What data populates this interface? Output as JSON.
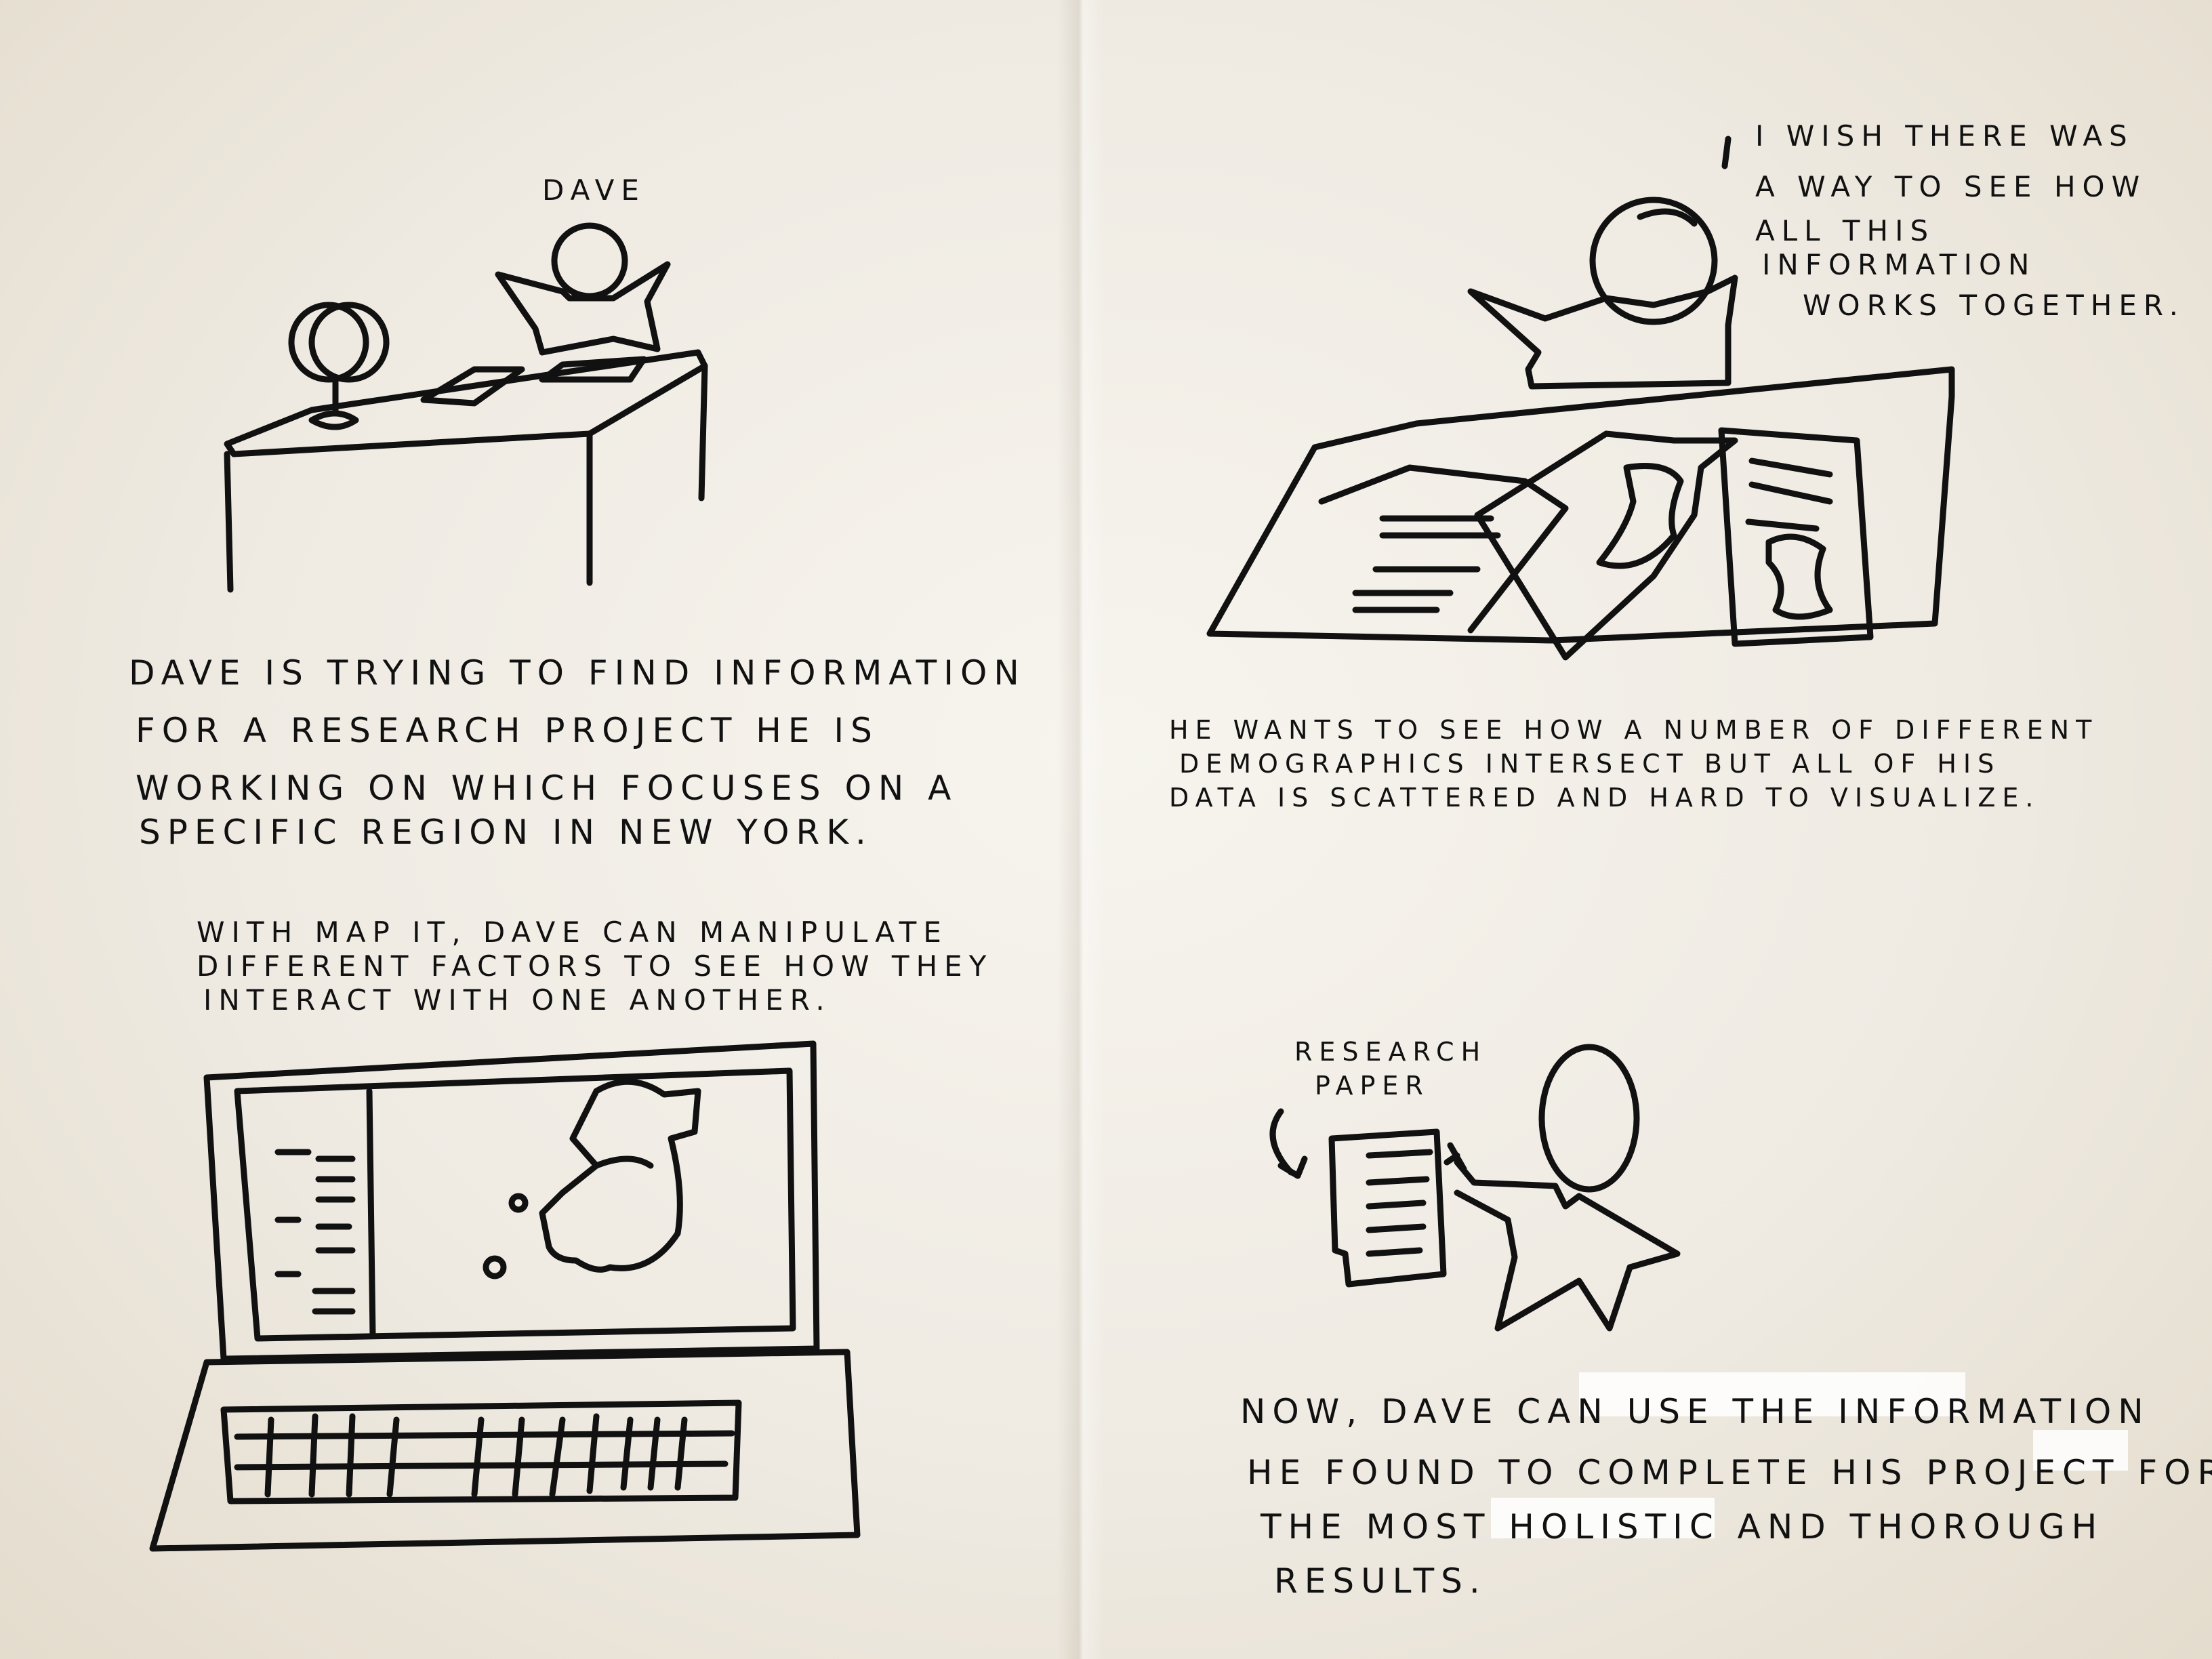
{
  "panel1": {
    "character_label": "DAVE",
    "caption": [
      "DAVE IS TRYING TO FIND INFORMATION",
      "FOR A RESEARCH PROJECT HE IS",
      "WORKING ON WHICH FOCUSES ON A",
      "SPECIFIC REGION IN NEW YORK."
    ]
  },
  "panel2": {
    "thought": [
      "I WISH THERE WAS",
      "A WAY TO SEE HOW",
      "ALL THIS",
      "INFORMATION",
      "WORKS TOGETHER."
    ],
    "caption": [
      "HE WANTS TO SEE HOW A NUMBER OF DIFFERENT",
      "DEMOGRAPHICS INTERSECT BUT ALL OF HIS",
      "DATA IS SCATTERED AND HARD TO VISUALIZE."
    ]
  },
  "panel3": {
    "caption": [
      "WITH MAP IT, DAVE CAN MANIPULATE",
      "DIFFERENT FACTORS TO SEE HOW THEY",
      "INTERACT WITH ONE ANOTHER."
    ]
  },
  "panel4": {
    "paper_label": [
      "RESEARCH",
      "PAPER"
    ],
    "caption": [
      "NOW, DAVE CAN USE THE INFORMATION",
      "HE FOUND TO COMPLETE HIS PROJECT FOR",
      "THE MOST HOLISTIC AND THOROUGH",
      "RESULTS."
    ]
  },
  "colors": {
    "ink": "#111111",
    "paper": "#f3efe7"
  }
}
